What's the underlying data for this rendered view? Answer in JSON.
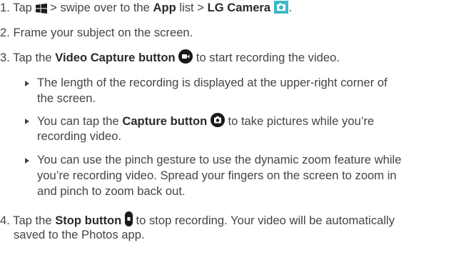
{
  "steps": [
    {
      "num": "1.",
      "parts": [
        "Tap ",
        " > swipe over to the ",
        "App",
        " list > ",
        "LG Camera",
        " ."
      ]
    },
    {
      "num": "2.",
      "text": "Frame your subject on the screen."
    },
    {
      "num": "3.",
      "parts": [
        "Tap the ",
        "Video Capture button",
        " to start recording the video."
      ]
    },
    {
      "num": "4.",
      "parts": [
        "Tap the ",
        "Stop button",
        " to stop recording. Your video will be automatically"
      ],
      "cont": "saved to the Photos app."
    }
  ],
  "bullets": [
    {
      "lines": [
        "The length of the recording is displayed at the upper-right corner of",
        "the screen."
      ]
    },
    {
      "parts": [
        "You can tap the ",
        "Capture button",
        " to take pictures while you’re"
      ],
      "cont": "recording video."
    },
    {
      "lines": [
        "You can use the pinch gesture to use the dynamic zoom feature while",
        "you’re recording video. Spread your fingers on the screen to zoom in",
        "and pinch to zoom back out."
      ]
    }
  ],
  "icons": {
    "windows": "windows-logo-icon",
    "camera_app": "lg-camera-app-icon",
    "video_capture": "video-capture-button-icon",
    "capture": "capture-button-icon",
    "stop": "stop-button-icon",
    "bullet": "triangle-bullet-icon"
  },
  "colors": {
    "text": "#444444",
    "icon_dark": "#1a1a1a",
    "camera_teal": "#3fb8c6"
  }
}
